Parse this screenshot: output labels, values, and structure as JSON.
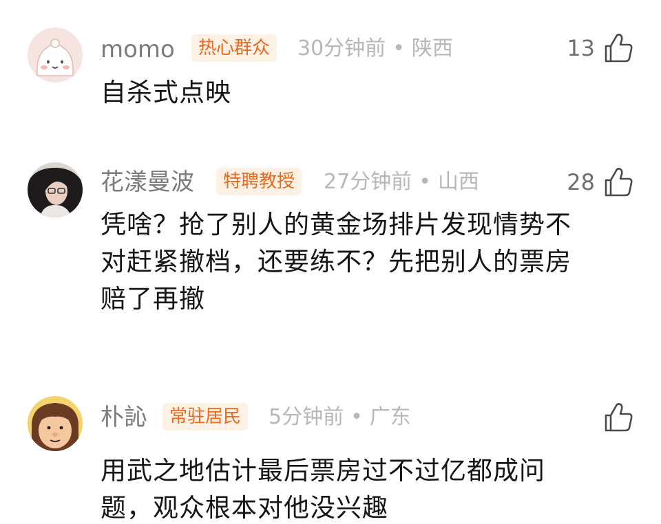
{
  "comments": [
    {
      "user": "momo",
      "badge": "热心群众",
      "time": "30分钟前",
      "location": "陕西",
      "likes": "13",
      "text": "自杀式点映",
      "avatar_icon": "cartoon-blob-avatar"
    },
    {
      "user": "花漾曼波",
      "badge": "特聘教授",
      "time": "27分钟前",
      "location": "山西",
      "likes": "28",
      "text": "凭啥？抢了别人的黄金场排片发现情势不\n对赶紧撤档，还要练不？先把别人的票房\n赔了再撤",
      "avatar_icon": "photo-avatar"
    },
    {
      "user": "朴訫",
      "badge": "常驻居民",
      "time": "5分钟前",
      "location": "广东",
      "likes": "",
      "text": "用武之地估计最后票房过不过亿都成问\n题，观众根本对他没兴趣",
      "avatar_icon": "cartoon-face-avatar"
    }
  ],
  "separator": "•",
  "colors": {
    "badge_bg": "#fdf1e6",
    "badge_text": "#e86a1f",
    "name": "#7b7b7b",
    "meta": "#b7b7b7"
  },
  "icons": {
    "like": "thumbs-up-icon"
  }
}
